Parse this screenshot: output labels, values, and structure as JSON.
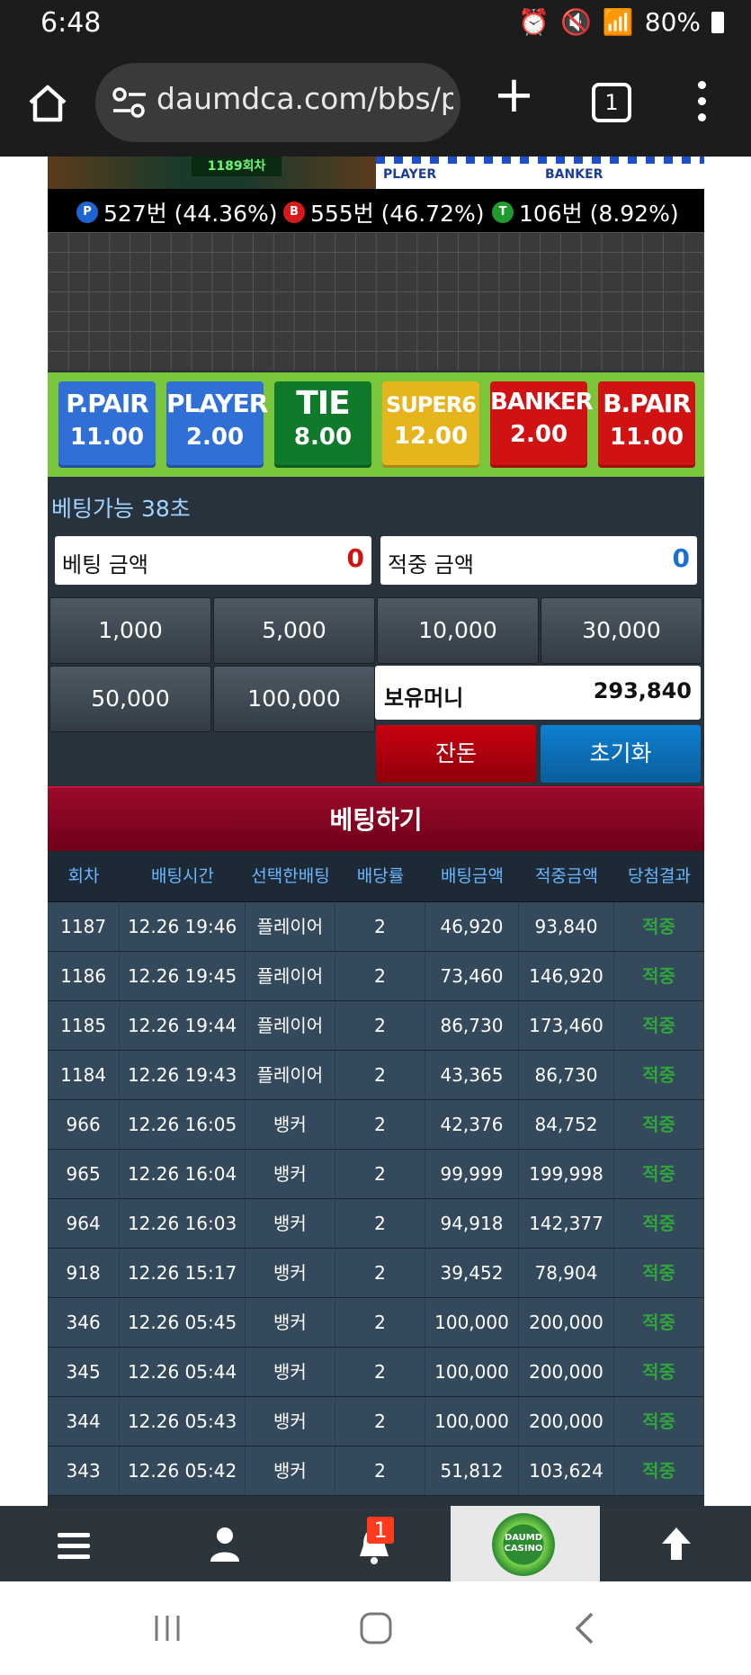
{
  "status_bar": {
    "time": "6:48",
    "battery": "80%"
  },
  "browser": {
    "url": "daumdca.com/bbs/p",
    "tab_count": "1"
  },
  "game": {
    "round_label": "1189회차",
    "mini_road_player": "PLAYER",
    "mini_road_banker": "BANKER",
    "stats": [
      {
        "badge": "P",
        "text": "527번 (44.36%)",
        "color": "#1d63d1"
      },
      {
        "badge": "B",
        "text": "555번 (46.72%)",
        "color": "#d81919"
      },
      {
        "badge": "T",
        "text": "106번 (8.92%)",
        "color": "#1f9a2c"
      }
    ]
  },
  "bet_options": [
    {
      "name": "P.PAIR",
      "odds": "11.00",
      "color": "#2f6fd6"
    },
    {
      "name": "PLAYER",
      "odds": "2.00",
      "color": "#2f6fd6"
    },
    {
      "name": "TIE",
      "odds": "8.00",
      "color": "#0f7a2a"
    },
    {
      "name": "SUPER6",
      "odds": "12.00",
      "color": "#e6b51d"
    },
    {
      "name": "BANKER",
      "odds": "2.00",
      "color": "#d01212"
    },
    {
      "name": "B.PAIR",
      "odds": "11.00",
      "color": "#d01212"
    }
  ],
  "betting": {
    "time_label": "베팅가능",
    "time_value": "38초",
    "bet_amount_label": "베팅 금액",
    "bet_amount_value": "0",
    "hit_amount_label": "적중 금액",
    "hit_amount_value": "0",
    "chips": [
      "1,000",
      "5,000",
      "10,000",
      "30,000",
      "50,000",
      "100,000"
    ],
    "money_label": "보유머니",
    "money_value": "293,840",
    "change_label": "잔돈",
    "reset_label": "초기화",
    "submit_label": "베팅하기"
  },
  "history": {
    "columns": [
      "회차",
      "배팅시간",
      "선택한배팅",
      "배당률",
      "배팅금액",
      "적중금액",
      "당첨결과"
    ],
    "rows": [
      [
        "1187",
        "12.26 19:46",
        "플레이어",
        "2",
        "46,920",
        "93,840",
        "적중"
      ],
      [
        "1186",
        "12.26 19:45",
        "플레이어",
        "2",
        "73,460",
        "146,920",
        "적중"
      ],
      [
        "1185",
        "12.26 19:44",
        "플레이어",
        "2",
        "86,730",
        "173,460",
        "적중"
      ],
      [
        "1184",
        "12.26 19:43",
        "플레이어",
        "2",
        "43,365",
        "86,730",
        "적중"
      ],
      [
        "966",
        "12.26 16:05",
        "뱅커",
        "2",
        "42,376",
        "84,752",
        "적중"
      ],
      [
        "965",
        "12.26 16:04",
        "뱅커",
        "2",
        "99,999",
        "199,998",
        "적중"
      ],
      [
        "964",
        "12.26 16:03",
        "뱅커",
        "2",
        "94,918",
        "142,377",
        "적중"
      ],
      [
        "918",
        "12.26 15:17",
        "뱅커",
        "2",
        "39,452",
        "78,904",
        "적중"
      ],
      [
        "346",
        "12.26 05:45",
        "뱅커",
        "2",
        "100,000",
        "200,000",
        "적중"
      ],
      [
        "345",
        "12.26 05:44",
        "뱅커",
        "2",
        "100,000",
        "200,000",
        "적중"
      ],
      [
        "344",
        "12.26 05:43",
        "뱅커",
        "2",
        "100,000",
        "200,000",
        "적중"
      ],
      [
        "343",
        "12.26 05:42",
        "뱅커",
        "2",
        "51,812",
        "103,624",
        "적중"
      ]
    ]
  },
  "bottom_nav": {
    "notification_count": "1",
    "logo_text": "DAUMD CASINO"
  },
  "colors": {
    "accent_green": "#79c63b",
    "bet_red": "#9c0a2a",
    "reset_blue": "#0b6fb8",
    "change_red": "#b8000f"
  }
}
